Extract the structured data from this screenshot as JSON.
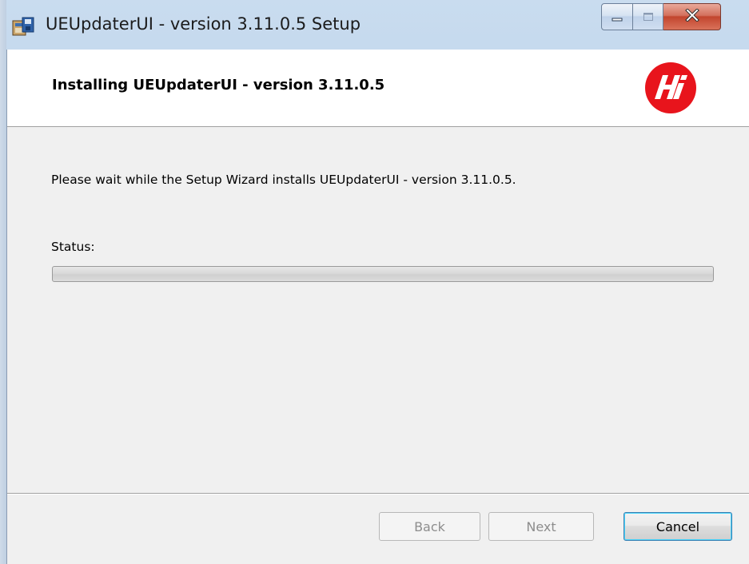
{
  "window": {
    "title": "UEUpdaterUI - version 3.11.0.5 Setup",
    "controls": {
      "minimize_icon": "minimize-icon",
      "maximize_icon": "maximize-icon",
      "close_icon": "close-icon"
    }
  },
  "header": {
    "title": "Installing UEUpdaterUI - version 3.11.0.5",
    "logo_icon": "hi-logo"
  },
  "body": {
    "description": "Please wait while the Setup Wizard installs UEUpdaterUI - version 3.11.0.5.",
    "status_label": "Status:",
    "progress_fraction": 0
  },
  "buttons": {
    "back": "Back",
    "next": "Next",
    "cancel": "Cancel"
  },
  "colors": {
    "logo_red": "#e8141c",
    "client_bg": "#f0f0f0",
    "accent_border": "#3c7fb1"
  }
}
